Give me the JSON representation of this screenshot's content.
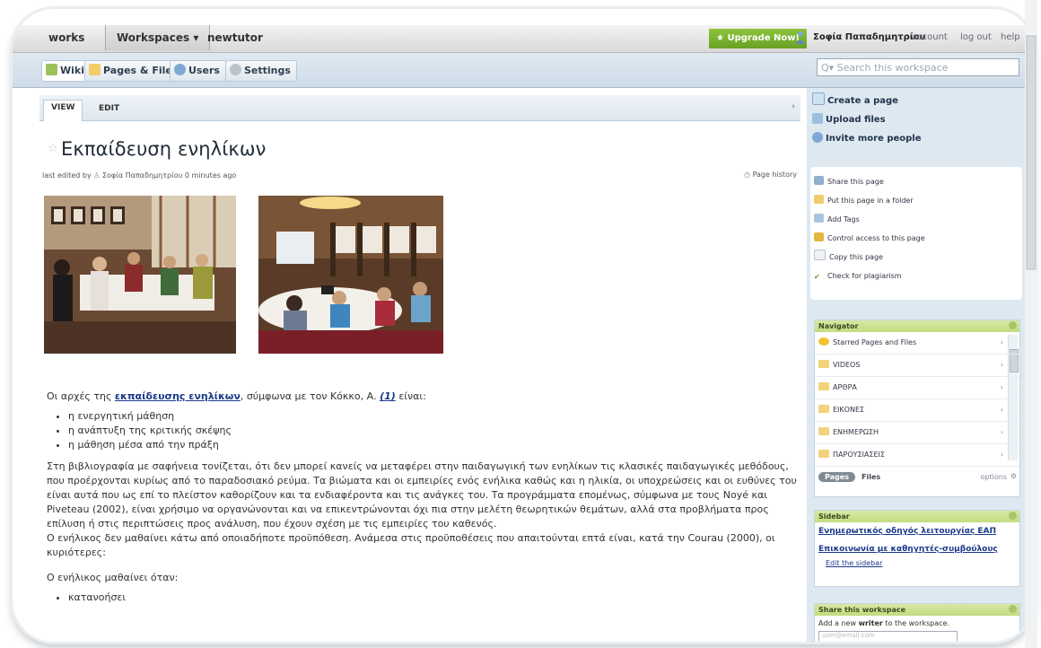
{
  "topbar": {
    "nav_label": "works",
    "workspaces_label": "Workspaces ▾",
    "workspace_name": "newtutor",
    "upgrade_label": "★ Upgrade Now!",
    "user_name": "Σοφία Παπαδημητρίου",
    "account_label": "account",
    "logout_label": "log out",
    "help_label": "help"
  },
  "tabs": [
    {
      "label": "Wiki",
      "icon": "wiki-icon"
    },
    {
      "label": "Pages & Files",
      "icon": "folder-icon"
    },
    {
      "label": "Users",
      "icon": "users-icon"
    },
    {
      "label": "Settings",
      "icon": "settings-icon"
    }
  ],
  "search": {
    "placeholder": "Q▾ Search this workspace"
  },
  "page": {
    "view_tab": "VIEW",
    "edit_tab": "EDIT",
    "title": "Εκπαίδευση ενηλίκων",
    "last_edited_prefix": "last edited by",
    "last_edited_user": "Σοφία Παπαδημητρίου",
    "last_edited_time": "0 minutes ago",
    "history_label": "Page history",
    "intro_before_link": "Οι αρχές της ",
    "intro_link": "εκπαίδευσης ενηλίκων",
    "intro_after_link": ", σύμφωνα με τον Κόκκο, Α. ",
    "intro_ref": "(1)",
    "intro_end": " είναι:",
    "bullets": [
      "η ενεργητική μάθηση",
      "η ανάπτυξη της κριτικής σκέψης",
      "η μάθηση μέσα από την πράξη"
    ],
    "paragraph1": "Στη βιβλιογραφία με σαφήνεια τονίζεται, ότι δεν μπορεί κανείς να μεταφέρει στην παιδαγωγική των ενηλίκων τις κλασικές παιδαγωγικές μεθόδους, που προέρχονται κυρίως από το παραδοσιακό ρεύμα. Τα βιώματα και οι εμπειρίες ενός ενήλικα καθώς και η ηλικία, οι υποχρεώσεις και οι ευθύνες του είναι αυτά που ως επί το πλείστον καθορίζουν και τα ενδιαφέροντα και τις ανάγκες του. Τα προγράμματα επομένως, σύμφωνα με τους Noyé και Piveteau (2002), είναι χρήσιμο να οργανώνονται και να επικεντρώνονται όχι πια στην μελέτη θεωρητικών θεμάτων, αλλά στα προβλήματα προς επίλυση ή στις περιπτώσεις προς ανάλυση, που έχουν σχέση με τις εμπειρίες του καθενός.",
    "paragraph2": "Ο ενήλικος δεν μαθαίνει κάτω από οποιαδήποτε προϋπόθεση. Ανάμεσα στις προϋποθέσεις που απαιτούνται επτά είναι, κατά την Courau (2000), οι κυριότερες:",
    "paragraph3": "Ο ενήλικος μαθαίνει όταν:",
    "bullets2": [
      "κατανοήσει"
    ]
  },
  "actions": [
    {
      "label": "Create a page",
      "icon": "new-page-icon"
    },
    {
      "label": "Upload files",
      "icon": "upload-icon"
    },
    {
      "label": "Invite more people",
      "icon": "invite-icon"
    }
  ],
  "page_actions": [
    {
      "label": "Share this page",
      "icon": "share-icon"
    },
    {
      "label": "Put this page in a folder",
      "icon": "folder-icon"
    },
    {
      "label": "Add Tags",
      "icon": "tag-icon"
    },
    {
      "label": "Control access to this page",
      "icon": "key-icon"
    },
    {
      "label": "Copy this page",
      "icon": "copy-icon"
    },
    {
      "label": "Check for plagiarism",
      "icon": "check-icon"
    }
  ],
  "navigator": {
    "title": "Navigator",
    "items": [
      {
        "label": "Starred Pages and Files",
        "icon": "star-icon"
      },
      {
        "label": "VIDEOS",
        "icon": "folder-icon"
      },
      {
        "label": "ΑΡΘΡΑ",
        "icon": "folder-icon"
      },
      {
        "label": "ΕΙΚΟΝΕΣ",
        "icon": "folder-icon"
      },
      {
        "label": "ΕΝΗΜΕΡΩΣΗ",
        "icon": "folder-icon"
      },
      {
        "label": "ΠΑΡΟΥΣΙΑΣΕΙΣ",
        "icon": "folder-icon"
      }
    ],
    "pages_tab": "Pages",
    "files_tab": "Files",
    "options_label": "options"
  },
  "sidebar": {
    "title": "Sidebar",
    "links": [
      "Ενημερωτικός οδηγός λειτουργίας ΕΑΠ",
      "Επικοινωνία με καθηγητές-συμβούλους"
    ],
    "edit_label": "Edit the sidebar"
  },
  "share_ws": {
    "title": "Share this workspace",
    "text_before": "Add a new ",
    "text_bold": "writer",
    "text_after": " to the workspace.",
    "email_placeholder": "user@email.com"
  },
  "colors": {
    "accent_green": "#7ab32e",
    "link_blue": "#1a3a8a",
    "panel_header": "#c8df8a",
    "sidebar_bg": "#dde8f0"
  }
}
